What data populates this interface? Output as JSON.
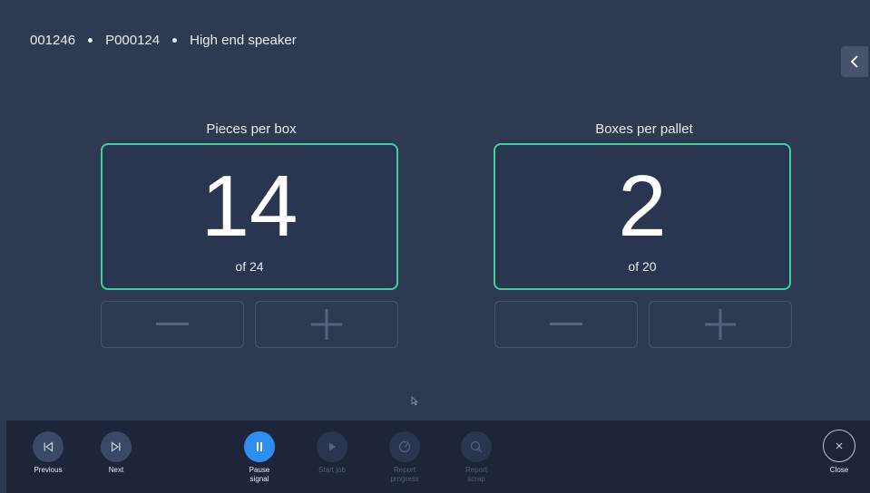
{
  "header": {
    "order_id": "001246",
    "product_id": "P000124",
    "product_name": "High end speaker"
  },
  "counters": [
    {
      "title": "Pieces per box",
      "value": "14",
      "of_label": "of 24"
    },
    {
      "title": "Boxes per pallet",
      "value": "2",
      "of_label": "of 20"
    }
  ],
  "toolbar": {
    "previous": "Previous",
    "next": "Next",
    "pause_line1": "Pause",
    "pause_line2": "signal",
    "start_job": "Start job",
    "report_progress_line1": "Report",
    "report_progress_line2": "progress",
    "report_scrap_line1": "Report",
    "report_scrap_line2": "scrap",
    "close": "Close"
  },
  "colors": {
    "background": "#2d3a52",
    "toolbar": "#1c253a",
    "accent_green": "#3bd19a",
    "primary_blue": "#2e8ff0"
  },
  "icons": [
    "chevron-left-icon",
    "minus-icon",
    "plus-icon",
    "skip-previous-icon",
    "skip-next-icon",
    "pause-icon",
    "play-icon",
    "gauge-icon",
    "scrap-search-icon",
    "close-icon"
  ]
}
